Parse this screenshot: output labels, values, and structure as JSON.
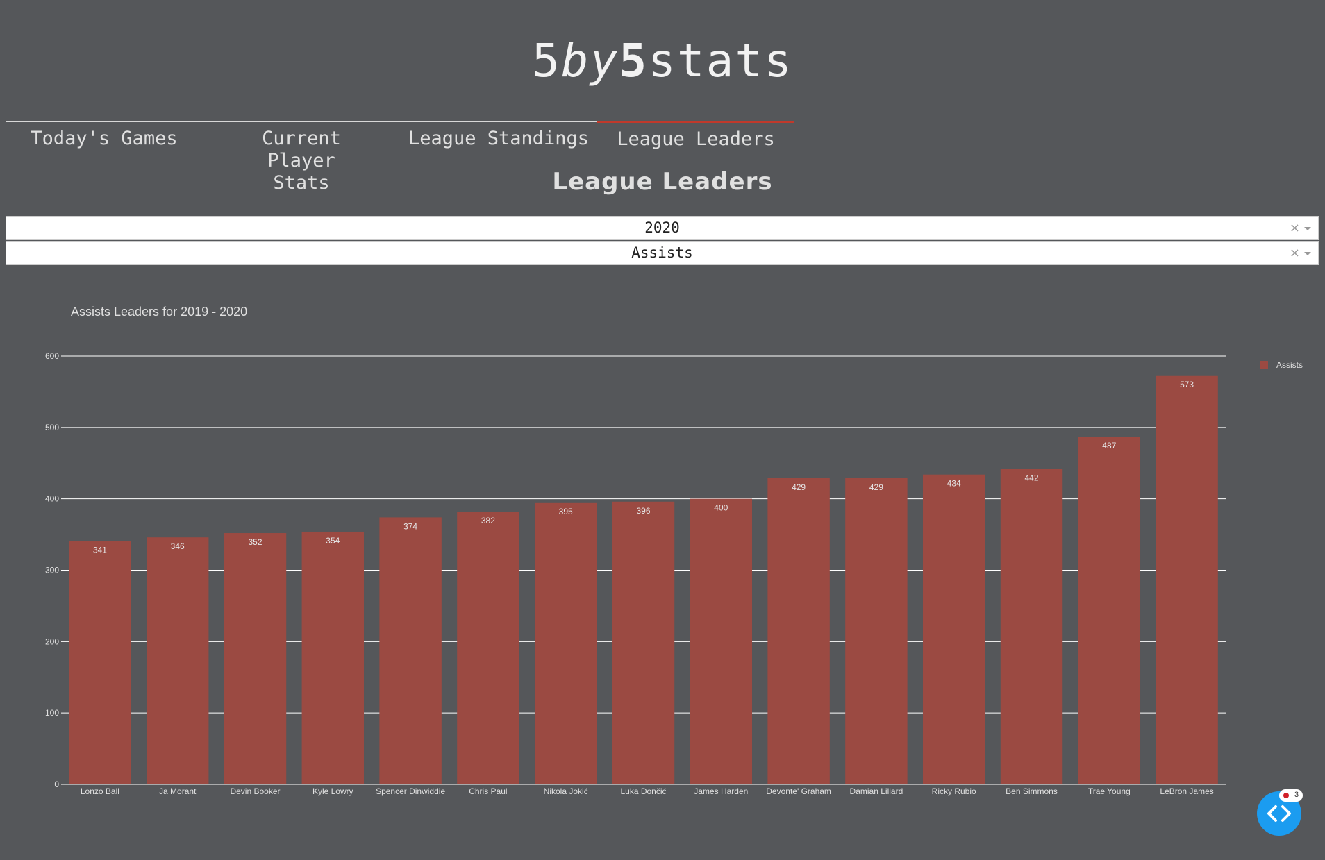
{
  "brand": {
    "part1": "5",
    "part2": "by",
    "part3": "5",
    "part4": "stats"
  },
  "nav": {
    "tabs": [
      {
        "label": "Today's Games"
      },
      {
        "label": "Current Player Stats"
      },
      {
        "label": "League Standings"
      },
      {
        "label": "League Leaders"
      }
    ],
    "active": "League Leaders"
  },
  "page": {
    "title": "League Leaders"
  },
  "filters": {
    "season": {
      "value": "2020"
    },
    "stat": {
      "value": "Assists"
    }
  },
  "colors": {
    "accent": "#c0392b",
    "bar": "#9b4a42",
    "background": "#55575a",
    "fab": "#1b9cf0"
  },
  "fab": {
    "icon": "code-icon",
    "badge": "3"
  },
  "chart_data": {
    "type": "bar",
    "title": "Assists Leaders for 2019 - 2020",
    "categories": [
      "Lonzo Ball",
      "Ja Morant",
      "Devin Booker",
      "Kyle Lowry",
      "Spencer Dinwiddie",
      "Chris Paul",
      "Nikola Jokić",
      "Luka Dončić",
      "James Harden",
      "Devonte' Graham",
      "Damian Lillard",
      "Ricky Rubio",
      "Ben Simmons",
      "Trae Young",
      "LeBron James"
    ],
    "series": [
      {
        "name": "Assists",
        "values": [
          341,
          346,
          352,
          354,
          374,
          382,
          395,
          396,
          400,
          429,
          429,
          434,
          442,
          487,
          573
        ]
      }
    ],
    "ylim": [
      0,
      600
    ],
    "yticks": [
      0,
      100,
      200,
      300,
      400,
      500,
      600
    ],
    "grid": true,
    "legend_position": "top-right"
  }
}
